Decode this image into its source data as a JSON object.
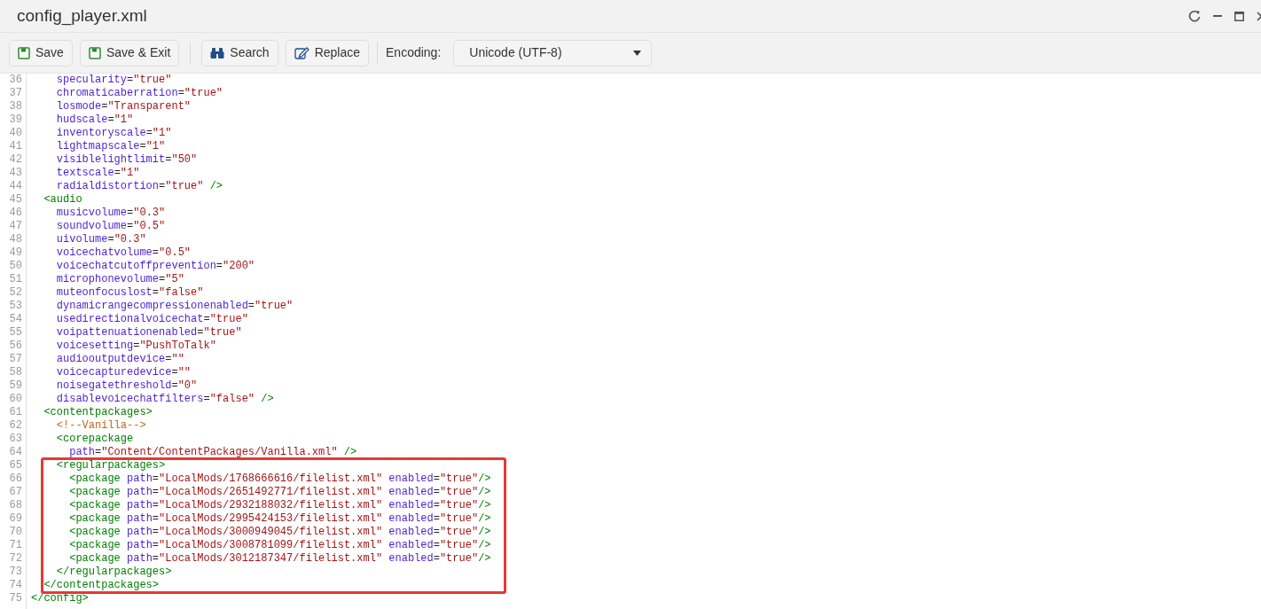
{
  "window": {
    "title": "config_player.xml"
  },
  "toolbar": {
    "buttons": [
      {
        "kind": "save",
        "label": "Save"
      },
      {
        "kind": "save",
        "label": "Save & Exit"
      },
      {
        "kind": "search",
        "label": "Search"
      },
      {
        "kind": "replace",
        "label": "Replace"
      }
    ],
    "encoding": {
      "label": "Encoding:",
      "value": "Unicode (UTF-8)"
    }
  },
  "editor": {
    "lines": [
      {
        "number": "36",
        "tokens": [
          {
            "kind": "attr",
            "text": "    specularity"
          },
          {
            "kind": "punct",
            "text": "="
          },
          {
            "kind": "value",
            "text": "\"true\""
          }
        ]
      },
      {
        "number": "37",
        "tokens": [
          {
            "kind": "attr",
            "text": "    chromaticaberration"
          },
          {
            "kind": "punct",
            "text": "="
          },
          {
            "kind": "value",
            "text": "\"true\""
          }
        ]
      },
      {
        "number": "38",
        "tokens": [
          {
            "kind": "attr",
            "text": "    losmode"
          },
          {
            "kind": "punct",
            "text": "="
          },
          {
            "kind": "value",
            "text": "\"Transparent\""
          }
        ]
      },
      {
        "number": "39",
        "tokens": [
          {
            "kind": "attr",
            "text": "    hudscale"
          },
          {
            "kind": "punct",
            "text": "="
          },
          {
            "kind": "value",
            "text": "\"1\""
          }
        ]
      },
      {
        "number": "40",
        "tokens": [
          {
            "kind": "attr",
            "text": "    inventoryscale"
          },
          {
            "kind": "punct",
            "text": "="
          },
          {
            "kind": "value",
            "text": "\"1\""
          }
        ]
      },
      {
        "number": "41",
        "tokens": [
          {
            "kind": "attr",
            "text": "    lightmapscale"
          },
          {
            "kind": "punct",
            "text": "="
          },
          {
            "kind": "value",
            "text": "\"1\""
          }
        ]
      },
      {
        "number": "42",
        "tokens": [
          {
            "kind": "attr",
            "text": "    visiblelightlimit"
          },
          {
            "kind": "punct",
            "text": "="
          },
          {
            "kind": "value",
            "text": "\"50\""
          }
        ]
      },
      {
        "number": "43",
        "tokens": [
          {
            "kind": "attr",
            "text": "    textscale"
          },
          {
            "kind": "punct",
            "text": "="
          },
          {
            "kind": "value",
            "text": "\"1\""
          }
        ]
      },
      {
        "number": "44",
        "tokens": [
          {
            "kind": "attr",
            "text": "    radialdistortion"
          },
          {
            "kind": "punct",
            "text": "="
          },
          {
            "kind": "value",
            "text": "\"true\""
          },
          {
            "kind": "tag",
            "text": " />"
          }
        ]
      },
      {
        "number": "45",
        "tokens": [
          {
            "kind": "tag",
            "text": "  <audio"
          }
        ]
      },
      {
        "number": "46",
        "tokens": [
          {
            "kind": "attr",
            "text": "    musicvolume"
          },
          {
            "kind": "punct",
            "text": "="
          },
          {
            "kind": "value",
            "text": "\"0.3\""
          }
        ]
      },
      {
        "number": "47",
        "tokens": [
          {
            "kind": "attr",
            "text": "    soundvolume"
          },
          {
            "kind": "punct",
            "text": "="
          },
          {
            "kind": "value",
            "text": "\"0.5\""
          }
        ]
      },
      {
        "number": "48",
        "tokens": [
          {
            "kind": "attr",
            "text": "    uivolume"
          },
          {
            "kind": "punct",
            "text": "="
          },
          {
            "kind": "value",
            "text": "\"0.3\""
          }
        ]
      },
      {
        "number": "49",
        "tokens": [
          {
            "kind": "attr",
            "text": "    voicechatvolume"
          },
          {
            "kind": "punct",
            "text": "="
          },
          {
            "kind": "value",
            "text": "\"0.5\""
          }
        ]
      },
      {
        "number": "50",
        "tokens": [
          {
            "kind": "attr",
            "text": "    voicechatcutoffprevention"
          },
          {
            "kind": "punct",
            "text": "="
          },
          {
            "kind": "value",
            "text": "\"200\""
          }
        ]
      },
      {
        "number": "51",
        "tokens": [
          {
            "kind": "attr",
            "text": "    microphonevolume"
          },
          {
            "kind": "punct",
            "text": "="
          },
          {
            "kind": "value",
            "text": "\"5\""
          }
        ]
      },
      {
        "number": "52",
        "tokens": [
          {
            "kind": "attr",
            "text": "    muteonfocuslost"
          },
          {
            "kind": "punct",
            "text": "="
          },
          {
            "kind": "value",
            "text": "\"false\""
          }
        ]
      },
      {
        "number": "53",
        "tokens": [
          {
            "kind": "attr",
            "text": "    dynamicrangecompressionenabled"
          },
          {
            "kind": "punct",
            "text": "="
          },
          {
            "kind": "value",
            "text": "\"true\""
          }
        ]
      },
      {
        "number": "54",
        "tokens": [
          {
            "kind": "attr",
            "text": "    usedirectionalvoicechat"
          },
          {
            "kind": "punct",
            "text": "="
          },
          {
            "kind": "value",
            "text": "\"true\""
          }
        ]
      },
      {
        "number": "55",
        "tokens": [
          {
            "kind": "attr",
            "text": "    voipattenuationenabled"
          },
          {
            "kind": "punct",
            "text": "="
          },
          {
            "kind": "value",
            "text": "\"true\""
          }
        ]
      },
      {
        "number": "56",
        "tokens": [
          {
            "kind": "attr",
            "text": "    voicesetting"
          },
          {
            "kind": "punct",
            "text": "="
          },
          {
            "kind": "value",
            "text": "\"PushToTalk\""
          }
        ]
      },
      {
        "number": "57",
        "tokens": [
          {
            "kind": "attr",
            "text": "    audiooutputdevice"
          },
          {
            "kind": "punct",
            "text": "="
          },
          {
            "kind": "value",
            "text": "\"\""
          }
        ]
      },
      {
        "number": "58",
        "tokens": [
          {
            "kind": "attr",
            "text": "    voicecapturedevice"
          },
          {
            "kind": "punct",
            "text": "="
          },
          {
            "kind": "value",
            "text": "\"\""
          }
        ]
      },
      {
        "number": "59",
        "tokens": [
          {
            "kind": "attr",
            "text": "    noisegatethreshold"
          },
          {
            "kind": "punct",
            "text": "="
          },
          {
            "kind": "value",
            "text": "\"0\""
          }
        ]
      },
      {
        "number": "60",
        "tokens": [
          {
            "kind": "attr",
            "text": "    disablevoicechatfilters"
          },
          {
            "kind": "punct",
            "text": "="
          },
          {
            "kind": "value",
            "text": "\"false\""
          },
          {
            "kind": "tag",
            "text": " />"
          }
        ]
      },
      {
        "number": "61",
        "tokens": [
          {
            "kind": "tag",
            "text": "  <contentpackages>"
          }
        ]
      },
      {
        "number": "62",
        "tokens": [
          {
            "kind": "comment",
            "text": "    <!--Vanilla-->"
          }
        ]
      },
      {
        "number": "63",
        "tokens": [
          {
            "kind": "tag",
            "text": "    <corepackage"
          }
        ]
      },
      {
        "number": "64",
        "tokens": [
          {
            "kind": "attr",
            "text": "      path"
          },
          {
            "kind": "punct",
            "text": "="
          },
          {
            "kind": "value",
            "text": "\"Content/ContentPackages/Vanilla.xml\""
          },
          {
            "kind": "tag",
            "text": " />"
          }
        ]
      }
    ],
    "highlighted_lines": [
      {
        "number": "65",
        "tokens": [
          {
            "kind": "tag",
            "text": "    <regularpackages>"
          }
        ]
      },
      {
        "number": "66",
        "tokens": [
          {
            "kind": "tag",
            "text": "      <package"
          },
          {
            "kind": "attr",
            "text": " path"
          },
          {
            "kind": "punct",
            "text": "="
          },
          {
            "kind": "value",
            "text": "\"LocalMods/1768666616/filelist.xml\""
          },
          {
            "kind": "attr",
            "text": " enabled"
          },
          {
            "kind": "punct",
            "text": "="
          },
          {
            "kind": "value",
            "text": "\"true\""
          },
          {
            "kind": "tag",
            "text": "/>"
          }
        ]
      },
      {
        "number": "67",
        "tokens": [
          {
            "kind": "tag",
            "text": "      <package"
          },
          {
            "kind": "attr",
            "text": " path"
          },
          {
            "kind": "punct",
            "text": "="
          },
          {
            "kind": "value",
            "text": "\"LocalMods/2651492771/filelist.xml\""
          },
          {
            "kind": "attr",
            "text": " enabled"
          },
          {
            "kind": "punct",
            "text": "="
          },
          {
            "kind": "value",
            "text": "\"true\""
          },
          {
            "kind": "tag",
            "text": "/>"
          }
        ]
      },
      {
        "number": "68",
        "tokens": [
          {
            "kind": "tag",
            "text": "      <package"
          },
          {
            "kind": "attr",
            "text": " path"
          },
          {
            "kind": "punct",
            "text": "="
          },
          {
            "kind": "value",
            "text": "\"LocalMods/2932188032/filelist.xml\""
          },
          {
            "kind": "attr",
            "text": " enabled"
          },
          {
            "kind": "punct",
            "text": "="
          },
          {
            "kind": "value",
            "text": "\"true\""
          },
          {
            "kind": "tag",
            "text": "/>"
          }
        ]
      },
      {
        "number": "69",
        "tokens": [
          {
            "kind": "tag",
            "text": "      <package"
          },
          {
            "kind": "attr",
            "text": " path"
          },
          {
            "kind": "punct",
            "text": "="
          },
          {
            "kind": "value",
            "text": "\"LocalMods/2995424153/filelist.xml\""
          },
          {
            "kind": "attr",
            "text": " enabled"
          },
          {
            "kind": "punct",
            "text": "="
          },
          {
            "kind": "value",
            "text": "\"true\""
          },
          {
            "kind": "tag",
            "text": "/>"
          }
        ]
      },
      {
        "number": "70",
        "tokens": [
          {
            "kind": "tag",
            "text": "      <package"
          },
          {
            "kind": "attr",
            "text": " path"
          },
          {
            "kind": "punct",
            "text": "="
          },
          {
            "kind": "value",
            "text": "\"LocalMods/3000949045/filelist.xml\""
          },
          {
            "kind": "attr",
            "text": " enabled"
          },
          {
            "kind": "punct",
            "text": "="
          },
          {
            "kind": "value",
            "text": "\"true\""
          },
          {
            "kind": "tag",
            "text": "/>"
          }
        ]
      },
      {
        "number": "71",
        "tokens": [
          {
            "kind": "tag",
            "text": "      <package"
          },
          {
            "kind": "attr",
            "text": " path"
          },
          {
            "kind": "punct",
            "text": "="
          },
          {
            "kind": "value",
            "text": "\"LocalMods/3008781099/filelist.xml\""
          },
          {
            "kind": "attr",
            "text": " enabled"
          },
          {
            "kind": "punct",
            "text": "="
          },
          {
            "kind": "value",
            "text": "\"true\""
          },
          {
            "kind": "tag",
            "text": "/>"
          }
        ]
      },
      {
        "number": "72",
        "tokens": [
          {
            "kind": "tag",
            "text": "      <package"
          },
          {
            "kind": "attr",
            "text": " path"
          },
          {
            "kind": "punct",
            "text": "="
          },
          {
            "kind": "value",
            "text": "\"LocalMods/3012187347/filelist.xml\""
          },
          {
            "kind": "attr",
            "text": " enabled"
          },
          {
            "kind": "punct",
            "text": "="
          },
          {
            "kind": "value",
            "text": "\"true\""
          },
          {
            "kind": "tag",
            "text": "/>"
          }
        ]
      },
      {
        "number": "73",
        "tokens": [
          {
            "kind": "tag",
            "text": "    </regularpackages>"
          }
        ]
      },
      {
        "number": "74",
        "tokens": [
          {
            "kind": "tag",
            "text": "  </contentpackages>"
          }
        ]
      }
    ],
    "lines_after": [
      {
        "number": "75",
        "tokens": [
          {
            "kind": "tag",
            "text": "</config>"
          }
        ]
      }
    ]
  }
}
